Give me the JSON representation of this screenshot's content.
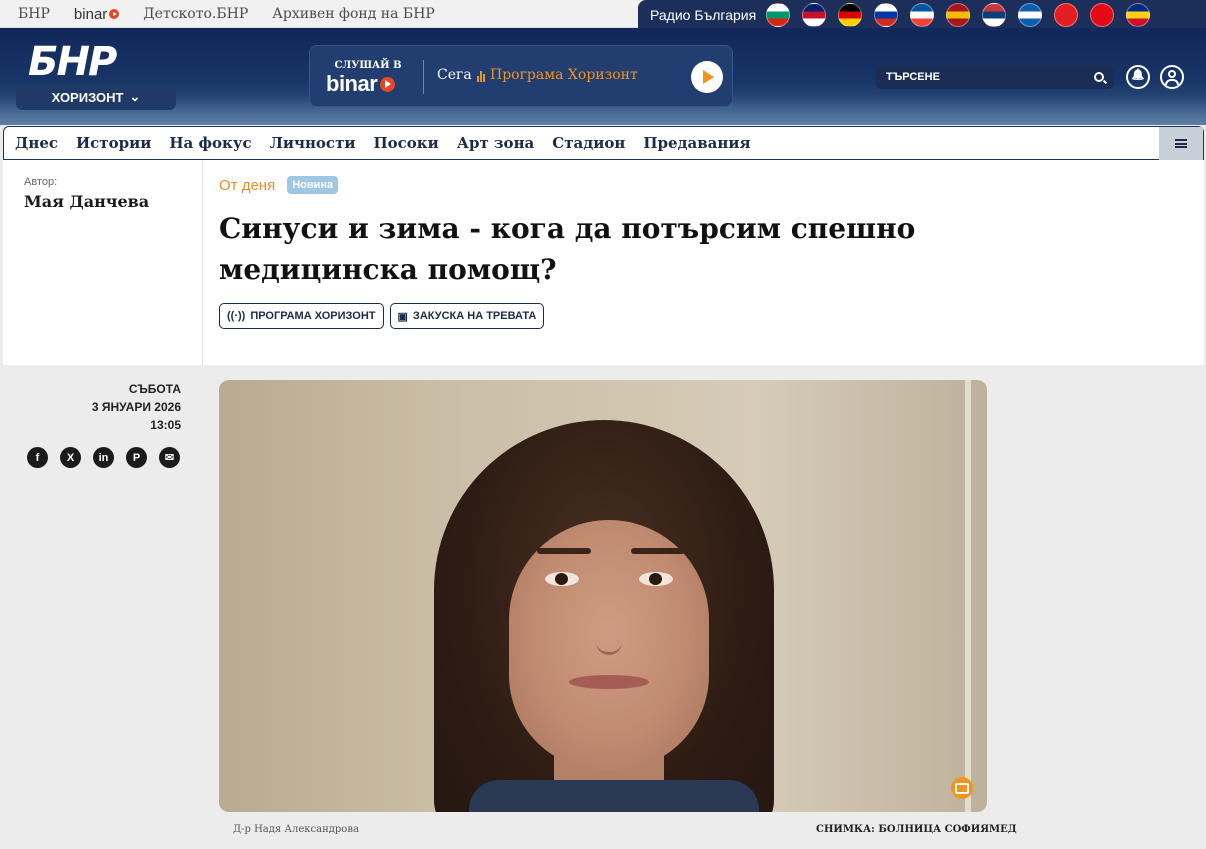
{
  "topbar": {
    "links": [
      "БНР",
      "binar",
      "Детското.БНР",
      "Архивен фонд на БНР"
    ],
    "radio_label": "Радио България",
    "flags": [
      {
        "name": "bulgaria-flag",
        "colors": [
          "#ffffff",
          "#00966e",
          "#d62612"
        ]
      },
      {
        "name": "uk-flag",
        "colors": [
          "#012169",
          "#c8102e",
          "#ffffff"
        ]
      },
      {
        "name": "germany-flag",
        "colors": [
          "#000000",
          "#dd0000",
          "#ffce00"
        ]
      },
      {
        "name": "russia-flag",
        "colors": [
          "#ffffff",
          "#0039a6",
          "#d52b1e"
        ]
      },
      {
        "name": "france-flag",
        "colors": [
          "#0055a4",
          "#ffffff",
          "#ef4135"
        ]
      },
      {
        "name": "spain-flag",
        "colors": [
          "#aa151b",
          "#f1bf00",
          "#aa151b"
        ]
      },
      {
        "name": "serbia-flag",
        "colors": [
          "#c6363c",
          "#0c4076",
          "#ffffff"
        ]
      },
      {
        "name": "greece-flag",
        "colors": [
          "#0d5eaf",
          "#ffffff",
          "#0d5eaf"
        ]
      },
      {
        "name": "albania-flag",
        "colors": [
          "#e41e20",
          "#e41e20",
          "#e41e20"
        ]
      },
      {
        "name": "turkey-flag",
        "colors": [
          "#e30a17",
          "#e30a17",
          "#e30a17"
        ]
      },
      {
        "name": "romania-flag",
        "colors": [
          "#002b7f",
          "#fcd116",
          "#ce1126"
        ]
      }
    ]
  },
  "header": {
    "logo": "БНР",
    "station": "ХОРИЗОНТ",
    "player": {
      "listen_label": "СЛУШАЙ В",
      "brand": "binar",
      "now_label": "Сега",
      "program": "Програма Хоризонт"
    },
    "search_placeholder": "ТЪРСЕНЕ"
  },
  "nav": {
    "items": [
      "Днес",
      "Истории",
      "На фокус",
      "Личности",
      "Посоки",
      "Арт зона",
      "Стадион",
      "Предавания"
    ]
  },
  "article": {
    "author_label": "Автор:",
    "author": "Мая Данчева",
    "category": "От деня",
    "badge": "Новина",
    "title": "Синуси и зима - кога да потърсим спешно медицинска помощ?",
    "tags": [
      "ПРОГРАМА ХОРИЗОНТ",
      "ЗАКУСКА НА ТРЕВАТА"
    ],
    "day": "СЪБОТА",
    "date": "3 ЯНУАРИ 2026",
    "time": "13:05",
    "share": [
      "f",
      "X",
      "in",
      "P",
      "✉"
    ],
    "caption": "Д-р Надя Александрова",
    "credit": "СНИМКА: БОЛНИЦА СОФИЯМЕД"
  },
  "colors": {
    "header_bg": "#12275a",
    "accent_orange": "#f3941e",
    "badge_blue": "#9fc7e5"
  }
}
